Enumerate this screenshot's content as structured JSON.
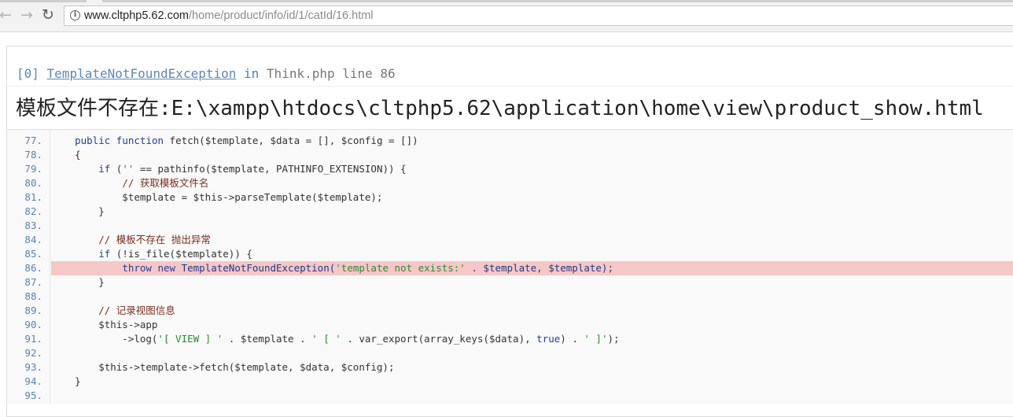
{
  "browser": {
    "url_host": "www.cltphp5.62.com",
    "url_path": "/home/product/info/id/1/catId/16.html"
  },
  "exception": {
    "index": "[0]",
    "class_name": "TemplateNotFoundException",
    "in_word": "in",
    "location": "Think.php line 86",
    "message": "模板文件不存在:E:\\xampp\\htdocs\\cltphp5.62\\application\\home\\view\\product_show.html"
  },
  "code": [
    {
      "n": "77.",
      "t": "    public function fetch($template, $data = [], $config = [])"
    },
    {
      "n": "78.",
      "t": "    {"
    },
    {
      "n": "79.",
      "t": "        if ('' == pathinfo($template, PATHINFO_EXTENSION)) {"
    },
    {
      "n": "80.",
      "t": "            // 获取模板文件名"
    },
    {
      "n": "81.",
      "t": "            $template = $this->parseTemplate($template);"
    },
    {
      "n": "82.",
      "t": "        }"
    },
    {
      "n": "83.",
      "t": ""
    },
    {
      "n": "84.",
      "t": "        // 模板不存在 抛出异常"
    },
    {
      "n": "85.",
      "t": "        if (!is_file($template)) {"
    },
    {
      "n": "86.",
      "t": "            throw new TemplateNotFoundException('template not exists:' . $template, $template);",
      "highlight": true
    },
    {
      "n": "87.",
      "t": "        }"
    },
    {
      "n": "88.",
      "t": ""
    },
    {
      "n": "89.",
      "t": "        // 记录视图信息"
    },
    {
      "n": "90.",
      "t": "        $this->app"
    },
    {
      "n": "91.",
      "t": "            ->log('[ VIEW ] ' . $template . ' [ ' . var_export(array_keys($data), true) . ' ]');"
    },
    {
      "n": "92.",
      "t": ""
    },
    {
      "n": "93.",
      "t": "        $this->template->fetch($template, $data, $config);"
    },
    {
      "n": "94.",
      "t": "    }"
    },
    {
      "n": "95.",
      "t": ""
    }
  ]
}
